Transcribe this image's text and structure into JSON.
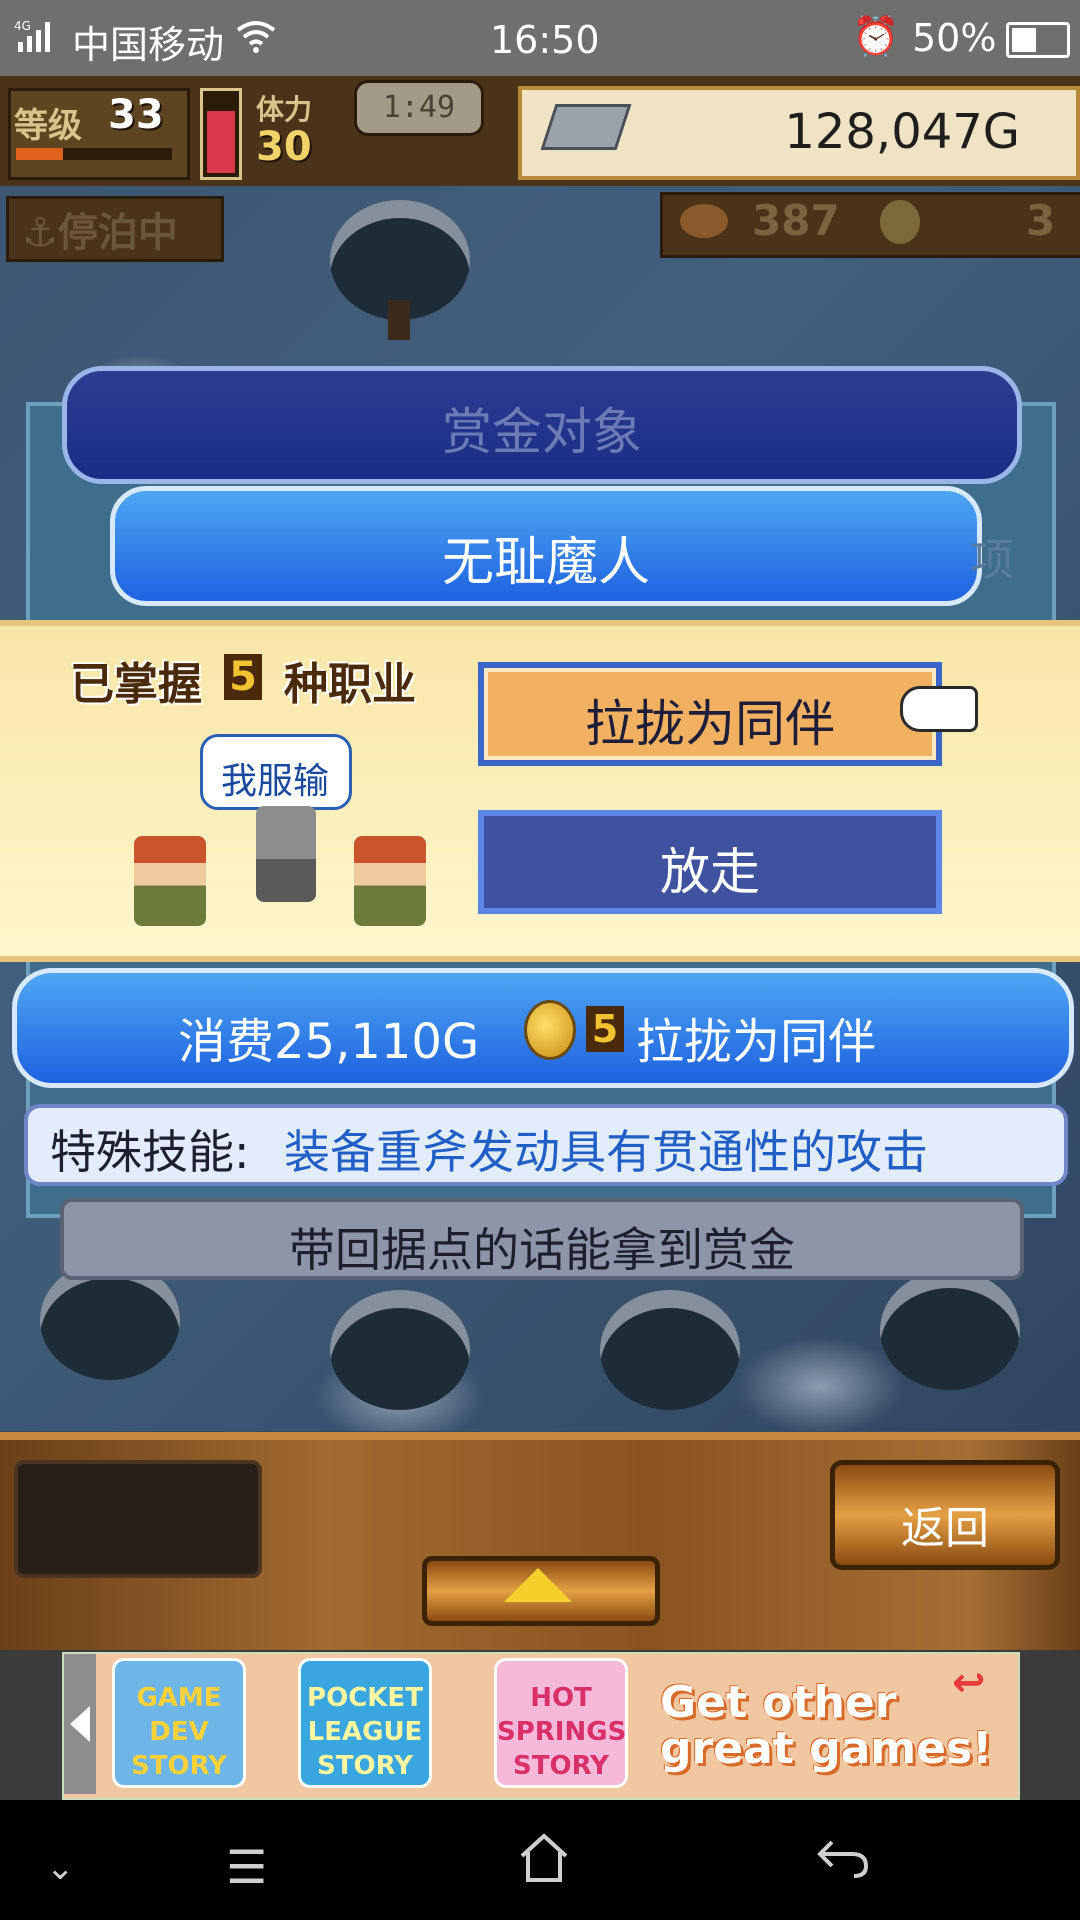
{
  "status_bar": {
    "network": "4G",
    "carrier": "中国移动",
    "time": "16:50",
    "battery": "50%"
  },
  "hud": {
    "level_label": "等级",
    "level": "33",
    "level_progress": 0.3,
    "stamina_label": "体力",
    "stamina": "30",
    "stamina_fill": 0.8,
    "timer": "1:49",
    "gold": "128,047G",
    "status": "停泊中",
    "food": "387",
    "coins": "3"
  },
  "bounty": {
    "header": "赏金对象",
    "target_name": "无耻魔人",
    "side_text": "项"
  },
  "popup": {
    "known_jobs_pre": "已掌握",
    "known_jobs_count": "5",
    "known_jobs_post": "种职业",
    "speech": "我服输",
    "recruit_label": "拉拢为同伴",
    "release_label": "放走"
  },
  "cost": {
    "pre": "消费25,110G",
    "coin_count": "5",
    "post": "拉拢为同伴"
  },
  "skill": {
    "label": "特殊技能:",
    "text": "装备重斧发动具有贯通性的攻击"
  },
  "note": "带回据点的话能拿到赏金",
  "bottom": {
    "back_label": "返回"
  },
  "ad": {
    "games": [
      "GAME DEV STORY",
      "POCKET LEAGUE STORY",
      "HOT SPRINGS STORY"
    ],
    "cta": "Get other great games!"
  },
  "colors": {
    "accent_blue": "#1e62e0",
    "popup_bg": "#fff6cc",
    "recruit_btn": "#f2b061",
    "release_btn": "#3f52a0",
    "skill_text": "#1f5fc6"
  }
}
